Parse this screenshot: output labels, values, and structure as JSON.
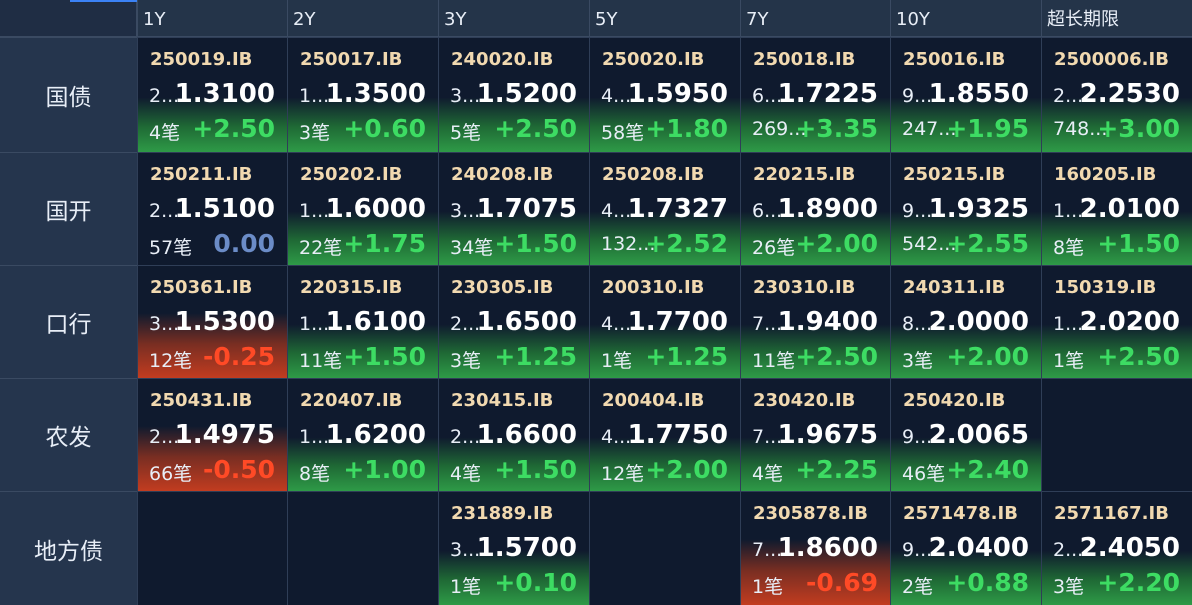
{
  "columns": [
    "1Y",
    "2Y",
    "3Y",
    "5Y",
    "7Y",
    "10Y",
    "超长期限"
  ],
  "rows": [
    {
      "label": "国债",
      "cells": [
        {
          "code": "250019.IB",
          "bal": "2...",
          "yield": "1.3100",
          "count": "4笔",
          "change": "+2.50",
          "dir": "up"
        },
        {
          "code": "250017.IB",
          "bal": "1...",
          "yield": "1.3500",
          "count": "3笔",
          "change": "+0.60",
          "dir": "up"
        },
        {
          "code": "240020.IB",
          "bal": "3...",
          "yield": "1.5200",
          "count": "5笔",
          "change": "+2.50",
          "dir": "up"
        },
        {
          "code": "250020.IB",
          "bal": "4...",
          "yield": "1.5950",
          "count": "58笔",
          "change": "+1.80",
          "dir": "up"
        },
        {
          "code": "250018.IB",
          "bal": "6...",
          "yield": "1.7225",
          "count": "269...",
          "change": "+3.35",
          "dir": "up"
        },
        {
          "code": "250016.IB",
          "bal": "9...",
          "yield": "1.8550",
          "count": "247...",
          "change": "+1.95",
          "dir": "up"
        },
        {
          "code": "2500006.IB",
          "bal": "2...",
          "yield": "2.2530",
          "count": "748...",
          "change": "+3.00",
          "dir": "up"
        }
      ]
    },
    {
      "label": "国开",
      "cells": [
        {
          "code": "250211.IB",
          "bal": "2...",
          "yield": "1.5100",
          "count": "57笔",
          "change": "0.00",
          "dir": "flat"
        },
        {
          "code": "250202.IB",
          "bal": "1...",
          "yield": "1.6000",
          "count": "22笔",
          "change": "+1.75",
          "dir": "up"
        },
        {
          "code": "240208.IB",
          "bal": "3...",
          "yield": "1.7075",
          "count": "34笔",
          "change": "+1.50",
          "dir": "up"
        },
        {
          "code": "250208.IB",
          "bal": "4...",
          "yield": "1.7327",
          "count": "132...",
          "change": "+2.52",
          "dir": "up"
        },
        {
          "code": "220215.IB",
          "bal": "6...",
          "yield": "1.8900",
          "count": "26笔",
          "change": "+2.00",
          "dir": "up"
        },
        {
          "code": "250215.IB",
          "bal": "9...",
          "yield": "1.9325",
          "count": "542...",
          "change": "+2.55",
          "dir": "up"
        },
        {
          "code": "160205.IB",
          "bal": "1...",
          "yield": "2.0100",
          "count": "8笔",
          "change": "+1.50",
          "dir": "up"
        }
      ]
    },
    {
      "label": "口行",
      "cells": [
        {
          "code": "250361.IB",
          "bal": "3...",
          "yield": "1.5300",
          "count": "12笔",
          "change": "-0.25",
          "dir": "down"
        },
        {
          "code": "220315.IB",
          "bal": "1...",
          "yield": "1.6100",
          "count": "11笔",
          "change": "+1.50",
          "dir": "up"
        },
        {
          "code": "230305.IB",
          "bal": "2...",
          "yield": "1.6500",
          "count": "3笔",
          "change": "+1.25",
          "dir": "up"
        },
        {
          "code": "200310.IB",
          "bal": "4...",
          "yield": "1.7700",
          "count": "1笔",
          "change": "+1.25",
          "dir": "up"
        },
        {
          "code": "230310.IB",
          "bal": "7...",
          "yield": "1.9400",
          "count": "11笔",
          "change": "+2.50",
          "dir": "up"
        },
        {
          "code": "240311.IB",
          "bal": "8...",
          "yield": "2.0000",
          "count": "3笔",
          "change": "+2.00",
          "dir": "up"
        },
        {
          "code": "150319.IB",
          "bal": "1...",
          "yield": "2.0200",
          "count": "1笔",
          "change": "+2.50",
          "dir": "up"
        }
      ]
    },
    {
      "label": "农发",
      "cells": [
        {
          "code": "250431.IB",
          "bal": "2...",
          "yield": "1.4975",
          "count": "66笔",
          "change": "-0.50",
          "dir": "down"
        },
        {
          "code": "220407.IB",
          "bal": "1...",
          "yield": "1.6200",
          "count": "8笔",
          "change": "+1.00",
          "dir": "up"
        },
        {
          "code": "230415.IB",
          "bal": "2...",
          "yield": "1.6600",
          "count": "4笔",
          "change": "+1.50",
          "dir": "up"
        },
        {
          "code": "200404.IB",
          "bal": "4...",
          "yield": "1.7750",
          "count": "12笔",
          "change": "+2.00",
          "dir": "up"
        },
        {
          "code": "230420.IB",
          "bal": "7...",
          "yield": "1.9675",
          "count": "4笔",
          "change": "+2.25",
          "dir": "up"
        },
        {
          "code": "250420.IB",
          "bal": "9...",
          "yield": "2.0065",
          "count": "46笔",
          "change": "+2.40",
          "dir": "up"
        },
        null
      ]
    },
    {
      "label": "地方债",
      "cells": [
        null,
        null,
        {
          "code": "231889.IB",
          "bal": "3...",
          "yield": "1.5700",
          "count": "1笔",
          "change": "+0.10",
          "dir": "up"
        },
        null,
        {
          "code": "2305878.IB",
          "bal": "7...",
          "yield": "1.8600",
          "count": "1笔",
          "change": "-0.69",
          "dir": "down"
        },
        {
          "code": "2571478.IB",
          "bal": "9...",
          "yield": "2.0400",
          "count": "2笔",
          "change": "+0.88",
          "dir": "up"
        },
        {
          "code": "2571167.IB",
          "bal": "2...",
          "yield": "2.4050",
          "count": "3笔",
          "change": "+2.20",
          "dir": "up"
        }
      ]
    }
  ]
}
